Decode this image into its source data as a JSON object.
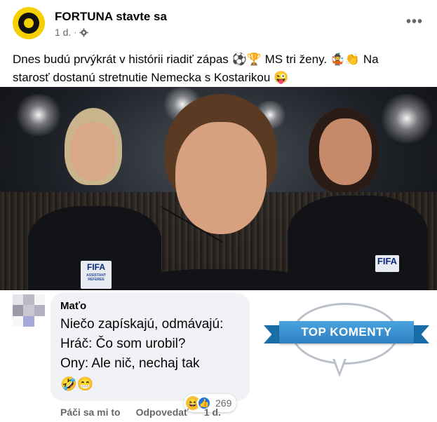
{
  "post": {
    "page_name": "FORTUNA stavte sa",
    "time": "1 d.",
    "privacy_icon": "gear-icon",
    "more_icon": "more-options-icon",
    "text_line1": "Dnes budú prvýkrát v histórii riadiť zápas ⚽🏆 MS tri ženy. 🤹👏 Na",
    "text_line2": "starosť dostanú stretnutie Nemecka s Kostarikou 😜"
  },
  "photo": {
    "badge_left": "FIFA",
    "badge_left_sub": "ASSISTANT REFEREE",
    "badge_right": "FIFA"
  },
  "comment": {
    "author": "Maťo",
    "line1": "Niečo zapískajú, odmávajú:",
    "line2": "Hráč: Čo som urobil?",
    "line3": "Ony: Ale nič, nechaj tak",
    "emoji": "🤣😁",
    "reaction_count": "269",
    "reaction_icons": [
      "haha-icon",
      "like-icon"
    ],
    "like_label": "Páči sa mi to",
    "reply_label": "Odpovedať",
    "time_label": "1 d."
  },
  "sticker": {
    "label": "TOP KOMENTY"
  },
  "colors": {
    "brand_yellow": "#f5d000",
    "facebook_blue": "#1b74e4",
    "bubble_bg": "#f0f2f5",
    "ribbon_blue": "#2d7fbf"
  }
}
